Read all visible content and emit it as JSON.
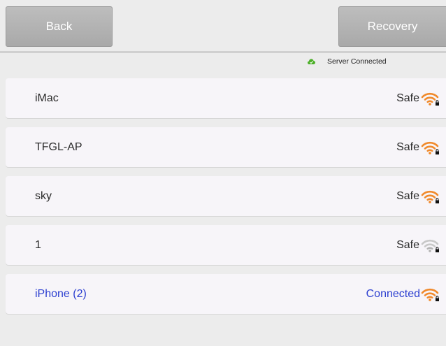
{
  "header": {
    "back_label": "Back",
    "recovery_label": "Recovery"
  },
  "status": {
    "text": "Server Connected",
    "icon": "cloud-check-icon",
    "color": "#4caf28"
  },
  "networks": [
    {
      "name": "iMac",
      "state": "Safe",
      "icon": "wifi-locked-icon",
      "icon_color": "#f08a2c"
    },
    {
      "name": "TFGL-AP",
      "state": "Safe",
      "icon": "wifi-locked-icon",
      "icon_color": "#f08a2c"
    },
    {
      "name": "sky",
      "state": "Safe",
      "icon": "wifi-locked-icon",
      "icon_color": "#f08a2c"
    },
    {
      "name": "1",
      "state": "Safe",
      "icon": "wifi-locked-icon",
      "icon_color": "#bdbdbd"
    },
    {
      "name": "iPhone (2)",
      "state": "Connected",
      "icon": "wifi-locked-icon",
      "icon_color": "#f08a2c"
    }
  ],
  "colors": {
    "connected_text": "#2c3fd0",
    "button_bg": "#b3b3b3",
    "row_bg": "#f7f5f9"
  }
}
